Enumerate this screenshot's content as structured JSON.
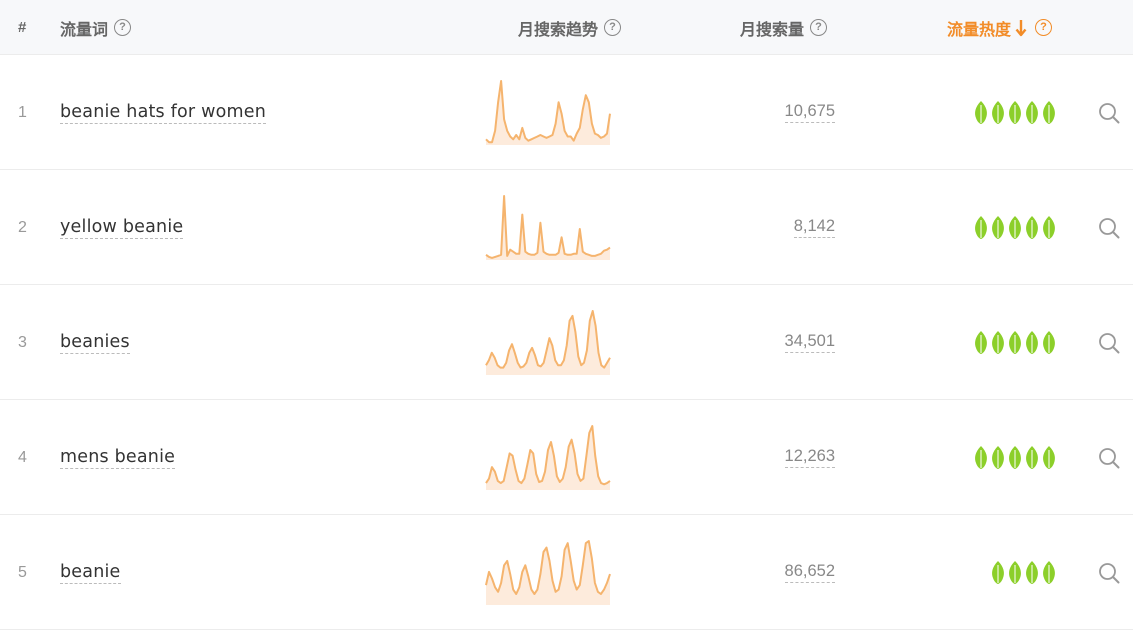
{
  "header": {
    "hash": "#",
    "keyword": "流量词",
    "trend": "月搜索趋势",
    "volume": "月搜索量",
    "heat": "流量热度",
    "help_glyph": "?"
  },
  "colors": {
    "accent": "#f28c28",
    "leaf": "#8ccf2a",
    "sparkline_stroke": "#f5b46e",
    "sparkline_fill": "#fdebdc"
  },
  "icons": {
    "help": "help-circle-icon",
    "sort": "arrow-down-icon",
    "heat": "leaf-icon",
    "search": "search-icon"
  },
  "rows": [
    {
      "rank": "1",
      "keyword": "beanie hats for women",
      "volume": "10,675",
      "heat": 5,
      "trend": [
        4,
        2,
        2,
        10,
        30,
        45,
        18,
        10,
        6,
        4,
        7,
        4,
        12,
        5,
        3,
        4,
        5,
        6,
        7,
        6,
        5,
        6,
        7,
        15,
        30,
        22,
        10,
        6,
        6,
        3,
        8,
        12,
        25,
        35,
        30,
        15,
        8,
        7,
        5,
        6,
        8,
        22
      ]
    },
    {
      "rank": "2",
      "keyword": "yellow beanie",
      "volume": "8,142",
      "heat": 5,
      "trend": [
        5,
        3,
        2,
        3,
        4,
        5,
        62,
        4,
        10,
        8,
        6,
        6,
        44,
        8,
        6,
        5,
        5,
        7,
        36,
        8,
        6,
        5,
        5,
        5,
        7,
        22,
        6,
        5,
        5,
        6,
        6,
        30,
        8,
        6,
        5,
        4,
        4,
        5,
        6,
        9,
        10,
        12
      ]
    },
    {
      "rank": "3",
      "keyword": "beanies",
      "volume": "34,501",
      "heat": 5,
      "trend": [
        8,
        12,
        18,
        14,
        8,
        6,
        6,
        10,
        20,
        25,
        18,
        10,
        6,
        7,
        10,
        18,
        22,
        16,
        8,
        7,
        10,
        20,
        30,
        24,
        12,
        8,
        8,
        12,
        24,
        44,
        48,
        35,
        15,
        8,
        10,
        20,
        44,
        52,
        40,
        18,
        8,
        6,
        10,
        14
      ]
    },
    {
      "rank": "4",
      "keyword": "mens beanie",
      "volume": "12,263",
      "heat": 5,
      "trend": [
        6,
        10,
        20,
        16,
        8,
        6,
        8,
        20,
        32,
        30,
        18,
        8,
        6,
        10,
        22,
        35,
        32,
        14,
        7,
        8,
        16,
        35,
        42,
        30,
        12,
        7,
        10,
        20,
        38,
        44,
        32,
        14,
        8,
        10,
        30,
        50,
        56,
        30,
        12,
        6,
        5,
        6,
        8
      ]
    },
    {
      "rank": "5",
      "keyword": "beanie",
      "volume": "86,652",
      "heat": 4,
      "trend": [
        18,
        30,
        24,
        16,
        12,
        20,
        36,
        40,
        28,
        14,
        10,
        16,
        30,
        36,
        26,
        14,
        10,
        14,
        28,
        48,
        52,
        40,
        22,
        12,
        14,
        26,
        50,
        56,
        40,
        22,
        14,
        18,
        36,
        56,
        58,
        42,
        20,
        12,
        10,
        14,
        20,
        28
      ]
    }
  ]
}
